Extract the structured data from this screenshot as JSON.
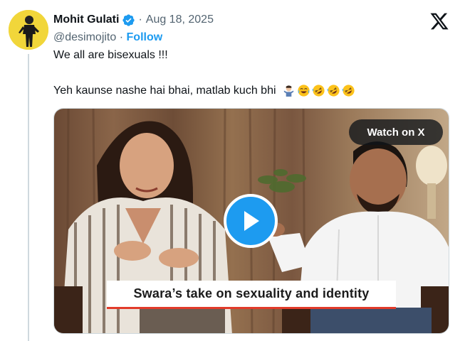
{
  "post": {
    "author_name": "Mohit Gulati",
    "date": "Aug 18, 2025",
    "separator": "·",
    "handle": "@desimojito",
    "follow_label": "Follow",
    "text_line1": "We all are bisexuals !!!",
    "text_line2": "Yeh kaunse nashe hai bhai, matlab kuch bhi",
    "emojis": [
      "man-shrugging-icon",
      "face-with-tears-of-joy-icon",
      "rolling-on-floor-laughing-icon",
      "rolling-on-floor-laughing-icon",
      "rolling-on-floor-laughing-icon"
    ]
  },
  "media": {
    "watch_label": "Watch on X",
    "caption": "Swara’s take on sexuality and identity"
  },
  "colors": {
    "accent": "#1d9bf0",
    "text": "#0f1419",
    "muted": "#536471",
    "caption_underline": "#e23b2a"
  }
}
